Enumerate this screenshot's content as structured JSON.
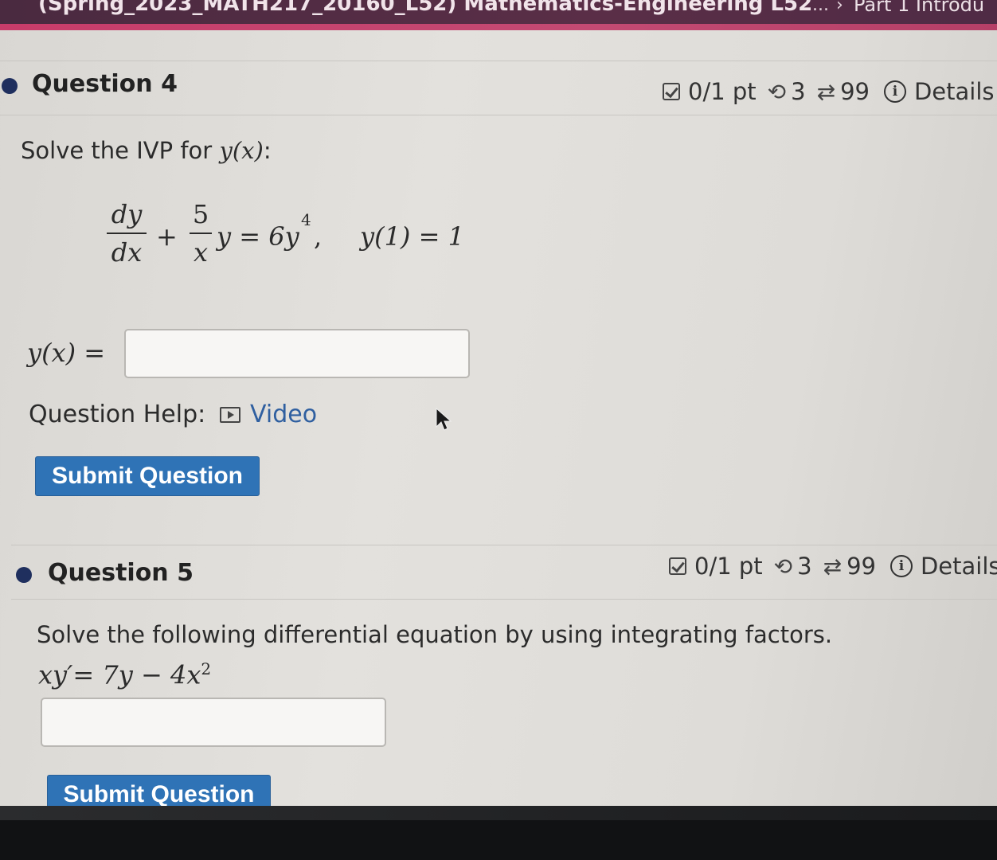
{
  "header": {
    "course_title": "(Spring_2023_MATH217_20160_L52) Mathematics-Engineering L52",
    "breadcrumb_ellipsis": "...",
    "breadcrumb_separator": "›",
    "breadcrumb_current": "Part 1 Introdu"
  },
  "question4": {
    "title": "Question 4",
    "score": "0/1 pt",
    "retries": "3",
    "attempts": "99",
    "details_label": "Details",
    "prompt_text": "Solve the IVP for ",
    "prompt_var": "y(x)",
    "prompt_colon": ":",
    "equation": {
      "frac1_num": "dy",
      "frac1_den": "dx",
      "plus": "+",
      "frac2_num": "5",
      "frac2_den": "x",
      "rest": "y = 6y",
      "exp": "4",
      "comma": ",",
      "initial": "y(1) = 1"
    },
    "answer_label": "y(x) =",
    "answer_value": "",
    "help_label": "Question Help:",
    "video_label": "Video",
    "submit_label": "Submit Question"
  },
  "question5": {
    "title": "Question 5",
    "score": "0/1 pt",
    "retries": "3",
    "attempts": "99",
    "details_label": "Details",
    "prompt_text": "Solve the following differential equation by using integrating factors.",
    "equation_main": "xy′= 7y − 4x",
    "equation_exp": "2",
    "answer_value": "",
    "submit_label": "Submit Question"
  },
  "icons": {
    "score": "checkbox-icon",
    "retry": "retry-icon",
    "attempts": "attempts-icon",
    "details": "info-icon",
    "video": "video-icon",
    "cursor": "mouse-cursor-icon"
  },
  "colors": {
    "header_bg": "#4f2b45",
    "header_accent": "#c83c6a",
    "submit_bg": "#2f73b6",
    "link": "#2f5fa0",
    "bullet": "#1f2f5e"
  }
}
